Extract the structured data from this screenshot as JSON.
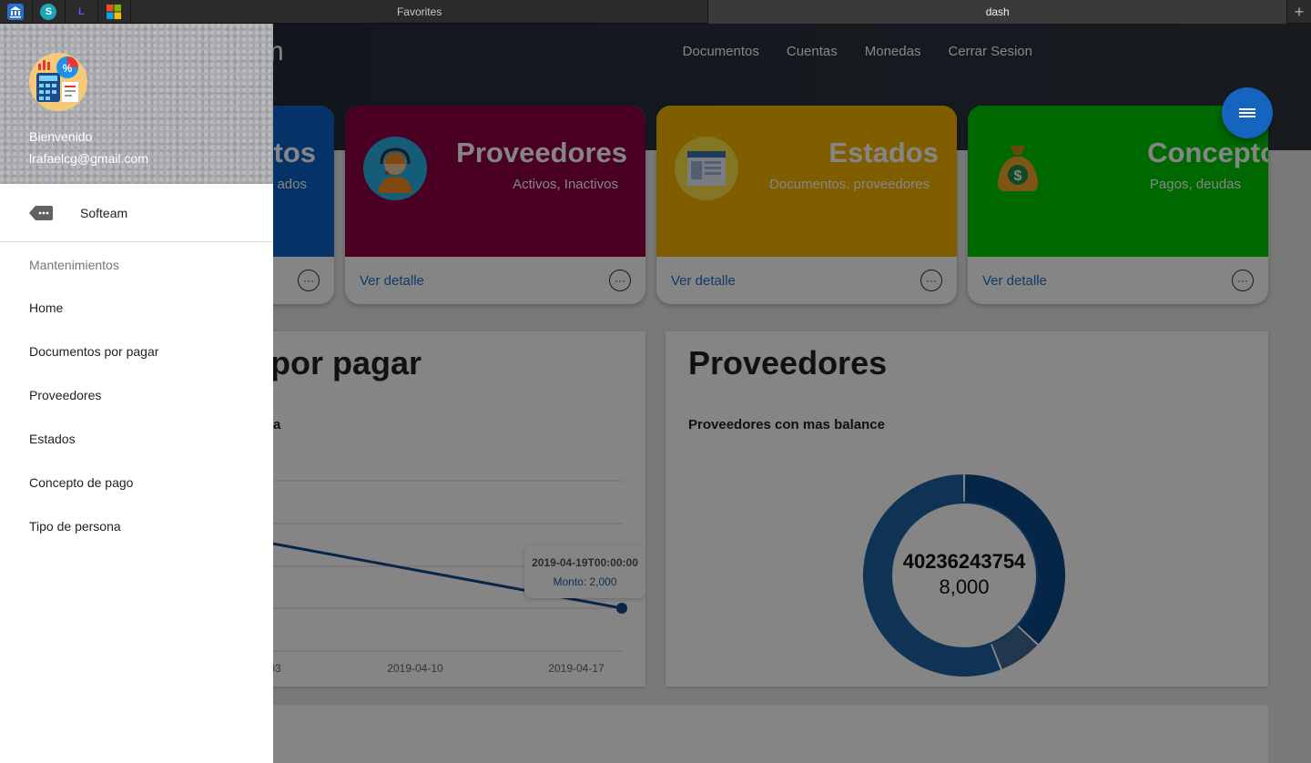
{
  "browser": {
    "favorites_tab": "Favorites",
    "active_tab": "dash",
    "new_tab": "+",
    "favicons": [
      "bank-icon",
      "s-circle-icon",
      "L",
      "windows-logo-icon"
    ]
  },
  "app": {
    "brand": "am",
    "topnav": [
      "Documentos",
      "Cuentas",
      "Monedas",
      "Cerrar Sesion"
    ],
    "cards": [
      {
        "title": "tos",
        "subtitle": "ados",
        "link": "",
        "color": "#0b63c8"
      },
      {
        "title": "Proveedores",
        "subtitle": "Activos, Inactivos",
        "link": "Ver detalle",
        "color": "#8c0041",
        "icon": "support-agent-icon"
      },
      {
        "title": "Estados",
        "subtitle": "Documentos, proveedores",
        "link": "Ver detalle",
        "color": "#f5b400",
        "icon": "document-icon"
      },
      {
        "title": "Concepto",
        "subtitle": "Pagos, deudas",
        "link": "Ver detalle",
        "color": "#00c800",
        "icon": "money-bag-icon"
      }
    ],
    "more_glyph": "···",
    "panel_left": {
      "title": "por pagar",
      "subtitle": "a",
      "chart_data": {
        "type": "line",
        "x": [
          "2019-04-03",
          "2019-04-10",
          "2019-04-17",
          "2019-04-19"
        ],
        "x_tick_labels": [
          "03",
          "2019-04-10",
          "2019-04-17"
        ],
        "series": [
          {
            "values": [
              null,
              null,
              null,
              2000
            ]
          }
        ],
        "tooltip": {
          "title": "2019-04-19T00:00:00",
          "label": "Monto: 2,000"
        },
        "grid": true
      }
    },
    "panel_right": {
      "title": "Proveedores",
      "subtitle": "Proveedores con mas balance",
      "chart_data": {
        "type": "pie",
        "center_label": "40236243754",
        "center_value": "8,000",
        "slices": [
          {
            "value": 37,
            "color": "#0d4a8a"
          },
          {
            "value": 7,
            "color": "#3f6a94"
          },
          {
            "value": 56,
            "color": "#1d63a4"
          }
        ]
      }
    }
  },
  "drawer": {
    "welcome": "Bienvenido",
    "email": "lrafaelcg@gmail.com",
    "brand_label": "Softeam",
    "section_header": "Mantenimientos",
    "items": [
      "Home",
      "Documentos por pagar",
      "Proveedores",
      "Estados",
      "Concepto de pago",
      "Tipo de persona"
    ]
  }
}
